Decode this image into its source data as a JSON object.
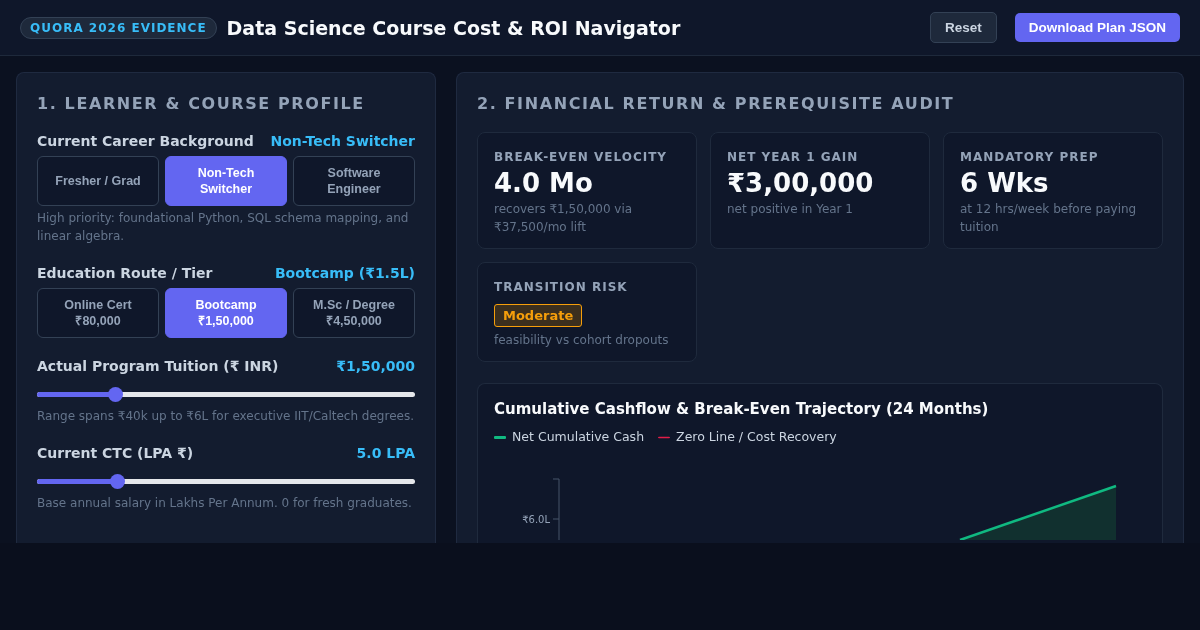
{
  "header": {
    "badge": "QUORA 2026 EVIDENCE",
    "title": "Data Science Course Cost & ROI Navigator",
    "buttons": [
      {
        "label": "Reset",
        "kind": "secondary"
      },
      {
        "label": "Download Plan JSON",
        "kind": "primary"
      }
    ]
  },
  "profile": {
    "title": "1. LEARNER & COURSE PROFILE",
    "fields": [
      {
        "kind": "segmented",
        "label": "Current Career Background",
        "value": "Non-Tech Switcher",
        "options": [
          {
            "label": "Fresher / Grad",
            "selected": false
          },
          {
            "label": "Non-Tech Switcher",
            "selected": true
          },
          {
            "label": "Software Engineer",
            "selected": false
          }
        ],
        "hint": "High priority: foundational Python, SQL schema mapping, and linear algebra."
      },
      {
        "kind": "segmented",
        "label": "Education Route / Tier",
        "value": "Bootcamp (₹1.5L)",
        "options": [
          {
            "label": "Online Cert",
            "price": "₹80,000",
            "selected": false
          },
          {
            "label": "Bootcamp",
            "price": "₹1,50,000",
            "selected": true
          },
          {
            "label": "M.Sc / Degree",
            "price": "₹4,50,000",
            "selected": false
          }
        ]
      },
      {
        "kind": "slider",
        "label": "Actual Program Tuition (₹ INR)",
        "value": "₹1,50,000",
        "level": 0.196,
        "hint": "Range spans ₹40k up to ₹6L for executive IIT/Caltech degrees."
      },
      {
        "kind": "slider",
        "label": "Current CTC (LPA ₹)",
        "value": "5.0 LPA",
        "level": 0.2,
        "hint": "Base annual salary in Lakhs Per Annum. 0 for fresh graduates."
      }
    ]
  },
  "audit": {
    "title": "2. FINANCIAL RETURN & PREREQUISITE AUDIT",
    "stats": [
      {
        "kind": "metric",
        "label": "BREAK-EVEN VELOCITY",
        "value": "4.0 Mo",
        "note": "recovers ₹1,50,000 via ₹37,500/mo lift"
      },
      {
        "kind": "metric",
        "label": "NET YEAR 1 GAIN",
        "value": "₹3,00,000",
        "note": "net positive in Year 1"
      },
      {
        "kind": "metric",
        "label": "MANDATORY PREP",
        "value": "6 Wks",
        "note": "at 12 hrs/week before paying tuition"
      },
      {
        "kind": "badge",
        "label": "TRANSITION RISK",
        "value": "Moderate",
        "note": "feasibility vs cohort dropouts"
      }
    ],
    "chart": {
      "title": "Cumulative Cashflow & Break-Even Trajectory (24 Months)",
      "legend": [
        {
          "label": "Net Cumulative Cash",
          "color": "#10b981"
        },
        {
          "label": "Zero Line / Cost Recovery",
          "color": "#e11d48"
        }
      ],
      "y_tick_label": "₹6.0L"
    }
  }
}
